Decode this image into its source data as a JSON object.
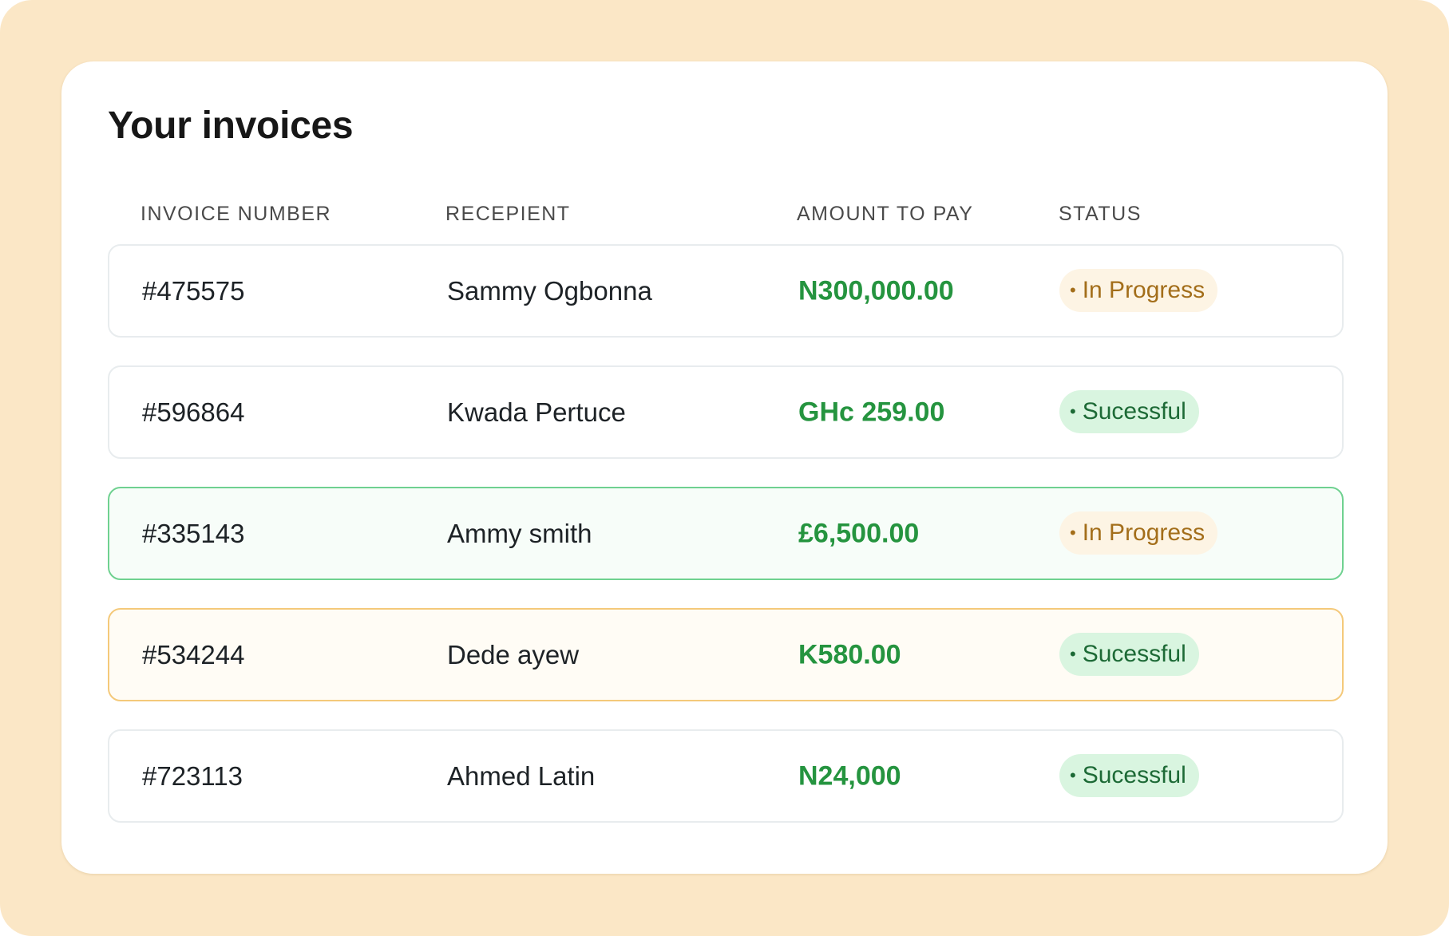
{
  "page": {
    "title": "Your invoices"
  },
  "columns": {
    "invoice_number": "INVOICE NUMBER",
    "recipient": "RECEPIENT",
    "amount": "AMOUNT TO PAY",
    "status": "STATUS"
  },
  "colors": {
    "background": "#fbe7c6",
    "card": "#ffffff",
    "amount_green": "#25943f",
    "status_progress_text": "#a36e1a",
    "status_progress_bg": "#fdf4e4",
    "status_success_text": "#1d6a36",
    "status_success_bg": "#d9f5e0",
    "highlight_green_border": "#6fd190",
    "highlight_amber_border": "#f4c97a"
  },
  "invoices": [
    {
      "number": "#475575",
      "recipient": "Sammy Ogbonna",
      "amount": "N300,000.00",
      "status": "In Progress",
      "status_dot": "•"
    },
    {
      "number": "#596864",
      "recipient": "Kwada Pertuce",
      "amount": "GHc 259.00",
      "status": "Sucessful",
      "status_dot": "•"
    },
    {
      "number": "#335143",
      "recipient": "Ammy smith",
      "amount": "£6,500.00",
      "status": "In Progress",
      "status_dot": "•"
    },
    {
      "number": "#534244",
      "recipient": "Dede ayew",
      "amount": "K580.00",
      "status": "Sucessful",
      "status_dot": "•"
    },
    {
      "number": "#723113",
      "recipient": "Ahmed Latin",
      "amount": "N24,000",
      "status": "Sucessful",
      "status_dot": "•"
    }
  ]
}
